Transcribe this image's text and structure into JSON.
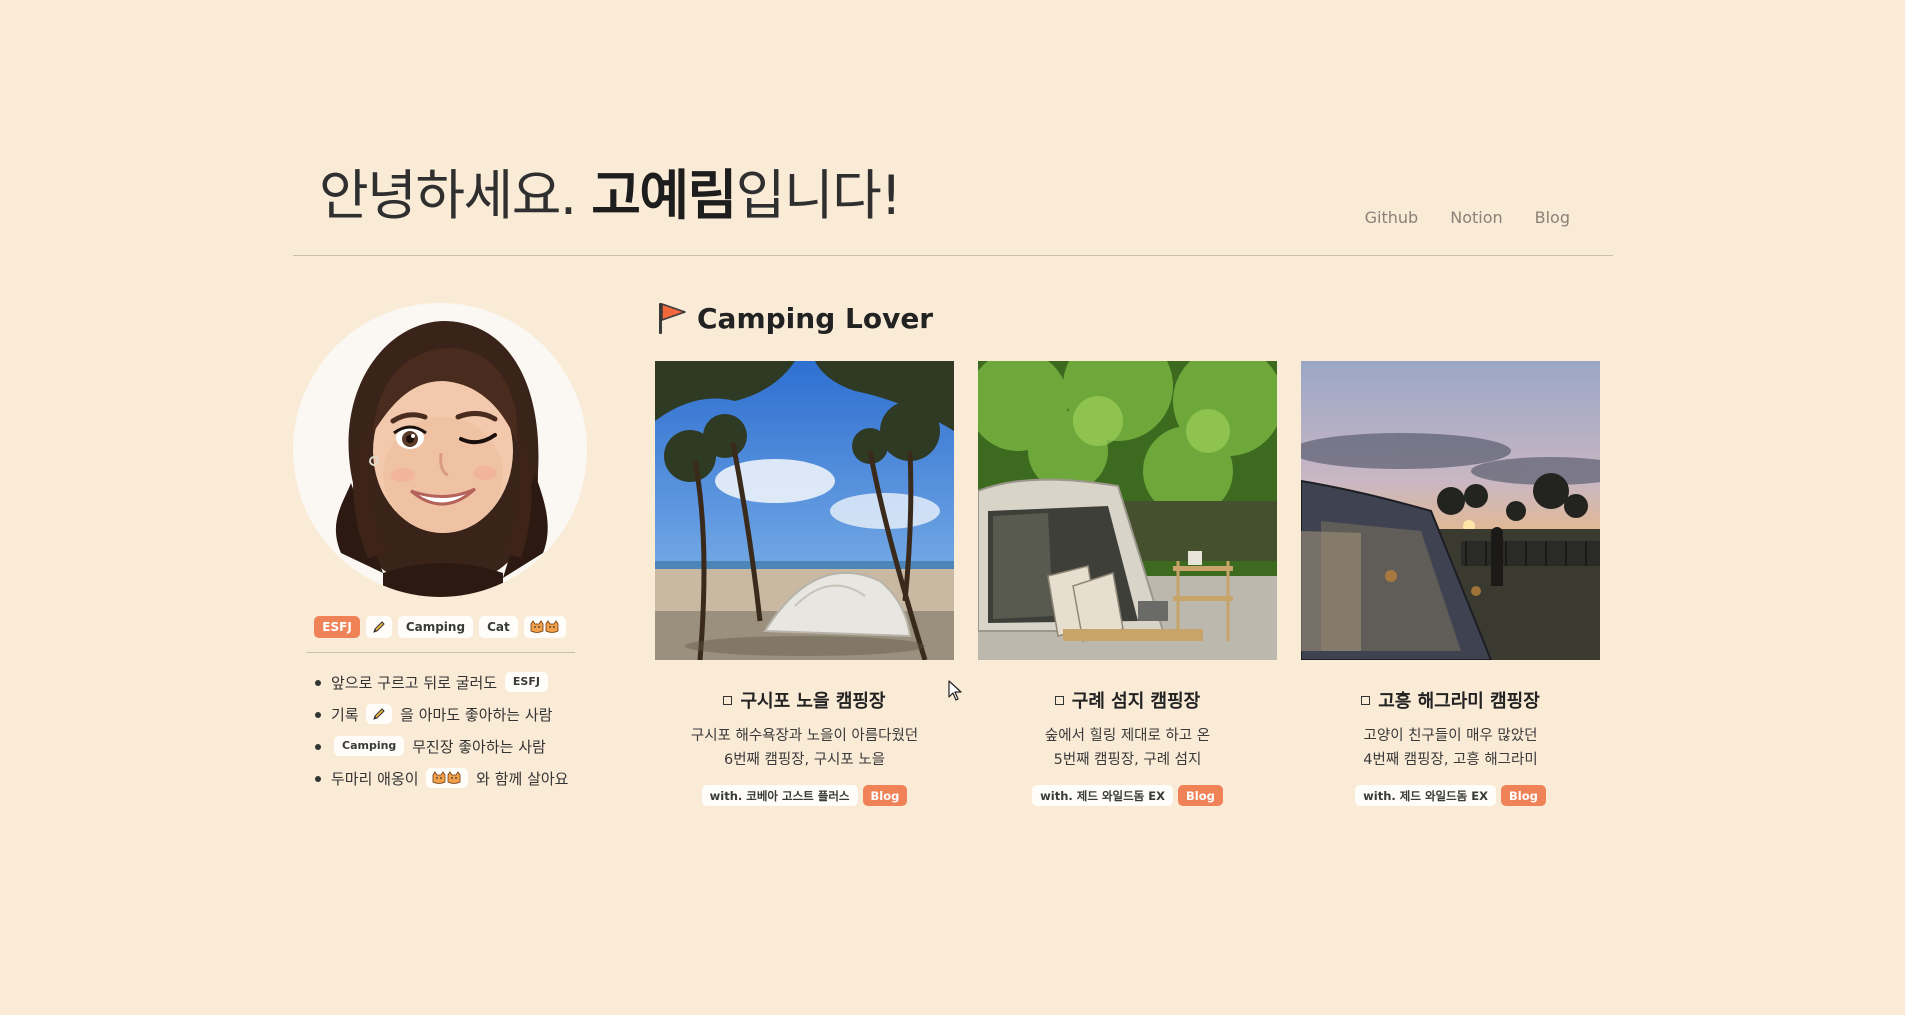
{
  "header": {
    "title_prefix": "안녕하세요. ",
    "title_name": "고예림",
    "title_suffix": "입니다!",
    "nav": [
      "Github",
      "Notion",
      "Blog"
    ]
  },
  "profile": {
    "tags": [
      "ESFJ",
      "pencil-icon",
      "Camping",
      "Cat",
      "cats-icon"
    ],
    "about": [
      {
        "before": "앞으로 구르고 뒤로 굴러도",
        "tag": "ESFJ",
        "after": ""
      },
      {
        "before": "기록",
        "tag_icon": "pencil-icon",
        "after": "을 아마도 좋아하는 사람"
      },
      {
        "before": "",
        "tag": "Camping",
        "after": "무진장 좋아하는 사람"
      },
      {
        "before": "두마리 애옹이",
        "tag_icon": "cats-icon",
        "after": "와 함께 살아요"
      }
    ]
  },
  "section": {
    "title": "Camping Lover",
    "icon": "flag-icon"
  },
  "cards": [
    {
      "title": "구시포 노을 캠핑장",
      "desc1": "구시포 해수욕장과 노을이 아름다웠던",
      "desc2": "6번째 캠핑장, 구시포 노을",
      "with": "with. 코베아 고스트 플러스",
      "blog": "Blog"
    },
    {
      "title": "구례 섬지 캠핑장",
      "desc1": "숲에서 힐링 제대로 하고 온",
      "desc2": "5번째 캠핑장, 구례 섬지",
      "with": "with. 제드 와일드돔 EX",
      "blog": "Blog"
    },
    {
      "title": "고흥 해그라미 캠핑장",
      "desc1": "고양이 친구들이 매우 많았던",
      "desc2": "4번째 캠핑장, 고흥 해그라미",
      "with": "with. 제드 와일드돔 EX",
      "blog": "Blog"
    }
  ],
  "colors": {
    "background": "#faebd7",
    "accent": "#f08258"
  }
}
